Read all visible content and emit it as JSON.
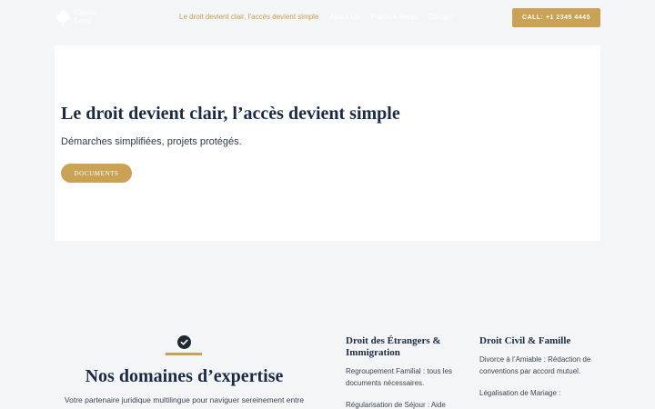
{
  "header": {
    "logo_line1": "Canada",
    "logo_line2": "Legal",
    "logo_icon": "maple-leaf-icon",
    "nav": [
      {
        "label": "Le droit devient clair, l’accès devient simple",
        "active": true
      },
      {
        "label": "About Us",
        "active": false
      },
      {
        "label": "Practice Areas",
        "active": false
      },
      {
        "label": "Contact",
        "active": false
      }
    ],
    "call_label": "CALL: +1 2345 4445"
  },
  "hero": {
    "title": "Le droit devient clair, l’accès devient simple",
    "subtitle": "Démarches simplifiées, projets protégés.",
    "button_label": "DOCUMENTS"
  },
  "expertise": {
    "icon": "check-circle-icon",
    "title": "Nos domaines d’expertise",
    "intro": "Votre partenaire juridique multilingue pour naviguer sereinement entre",
    "columns": [
      {
        "title": "Droit des Étrangers & Immigration",
        "items": [
          "Regroupement Familial : tous les documents nécessaires.",
          "Régularisation de Séjour : Aide"
        ]
      },
      {
        "title": "Droit Civil & Famille",
        "items": [
          "Divorce à l’Amiable : Rédaction de conventions par accord mutuel.",
          "Légalisation de Mariage :"
        ]
      }
    ]
  },
  "colors": {
    "accent": "#c9a256",
    "navy": "#1c2b45",
    "background": "#f4f5f7"
  }
}
